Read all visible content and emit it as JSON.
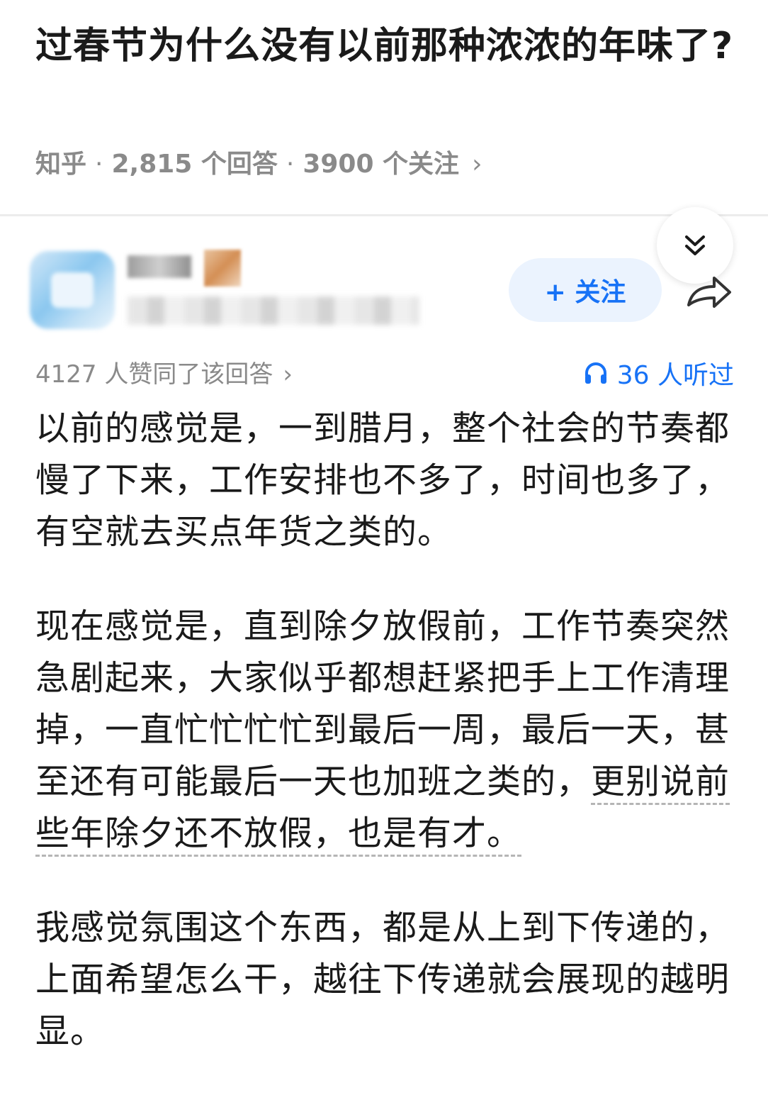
{
  "question": {
    "title": "过春节为什么没有以前那种浓浓的年味了?",
    "source": "知乎",
    "separator": "·",
    "answers": "2,815 个回答",
    "followers": "3900 个关注",
    "chevron": "›"
  },
  "author": {
    "follow_label": "+ 关注"
  },
  "answer": {
    "voteup_text": "4127 人赞同了该回答",
    "voteup_chevron": "›",
    "listened_text": "36 人听过",
    "paragraphs": [
      "以前的感觉是，一到腊月，整个社会的节奏都慢了下来，工作安排也不多了，时间也多了，有空就去买点年货之类的。",
      "现在感觉是，直到除夕放假前，工作节奏突然急剧起来，大家似乎都想赶紧把手上工作清理掉，一直忙忙忙忙到最后一周，最后一天，甚至还有可能最后一天也加班之类的，",
      "更别说前些年除夕还不放假，也是有才。",
      "我感觉氛围这个东西，都是从上到下传递的，上面希望怎么干，越往下传递就会展现的越明显。"
    ]
  },
  "colors": {
    "accent": "#1772f6",
    "follow_bg": "#ebf3fe",
    "meta_gray": "#8a8a8a",
    "text": "#1a1a1a"
  },
  "icons": {
    "collapse": "double-chevron-down-icon",
    "share": "share-arrow-icon",
    "listen": "headphone-icon"
  }
}
